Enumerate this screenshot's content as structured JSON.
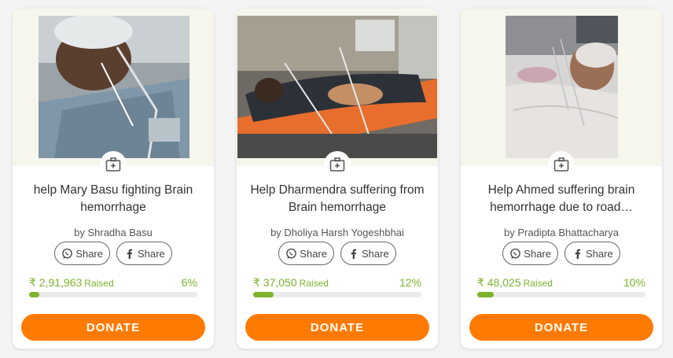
{
  "campaigns": [
    {
      "title": "help Mary Basu fighting Brain hemorrhage",
      "byline": "by Shradha Basu",
      "share_whatsapp": "Share",
      "share_facebook": "Share",
      "raised_amount": "₹ 2,91,963",
      "raised_word": "Raised",
      "percent_label": "6%",
      "percent": 6,
      "donate_label": "DONATE",
      "category_icon": "medical-kit-icon"
    },
    {
      "title": "Help Dharmendra suffering from Brain hemorrhage",
      "byline": "by Dholiya Harsh Yogeshbhai",
      "share_whatsapp": "Share",
      "share_facebook": "Share",
      "raised_amount": "₹ 37,050",
      "raised_word": "Raised",
      "percent_label": "12%",
      "percent": 12,
      "donate_label": "DONATE",
      "category_icon": "medical-kit-icon"
    },
    {
      "title": "Help Ahmed suffering brain hemorrhage due to road…",
      "byline": "by Pradipta Bhattacharya",
      "share_whatsapp": "Share",
      "share_facebook": "Share",
      "raised_amount": "₹ 48,025",
      "raised_word": "Raised",
      "percent_label": "10%",
      "percent": 10,
      "donate_label": "DONATE",
      "category_icon": "medical-kit-icon"
    }
  ],
  "colors": {
    "accent_green": "#7cb32b",
    "donate_orange": "#ff7a00",
    "image_bg": "#f7f6ec"
  }
}
